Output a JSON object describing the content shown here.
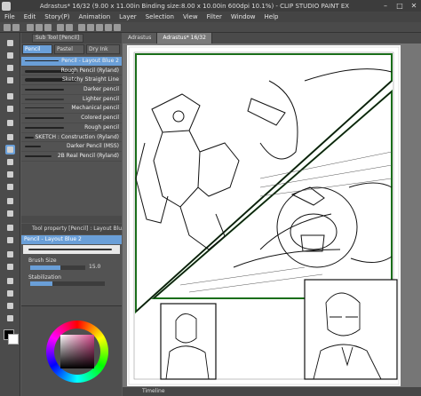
{
  "window": {
    "title": "Adrastus* 16/32 (9.00 x 11.00in Binding size:8.00 x 10.00in 600dpi 10.1%) - CLIP STUDIO PAINT EX",
    "minimize": "–",
    "maximize": "□",
    "close": "✕"
  },
  "menu": [
    "File",
    "Edit",
    "Story(P)",
    "Animation",
    "Layer",
    "Selection",
    "View",
    "Filter",
    "Window",
    "Help"
  ],
  "document_tabs": [
    "Adrastus",
    "Adrastus* 16/32"
  ],
  "subtool_panel": {
    "header": "Sub Tool [Pencil]",
    "tabs": [
      "Pencil",
      "Pastel",
      "Dry Ink"
    ],
    "active_tab": "Pencil",
    "brushes": [
      "Pencil - Layout Blue 2",
      "Rough Pencil (Ryland)",
      "Sketchy Straight Line",
      "Darker pencil",
      "Lighter pencil",
      "Mechanical pencil",
      "Colored pencil",
      "Rough pencil",
      "SKETCH : Construction (Ryland)",
      "Darker Pencil (MSS)",
      "2B Real Pencil (Ryland)"
    ],
    "selected_brush": "Pencil - Layout Blue 2"
  },
  "tool_property": {
    "header": "Tool property [Pencil] : Layout Blu...",
    "name": "Pencil - Layout Blue 2",
    "brush_size_label": "Brush Size",
    "brush_size_value": "15.0",
    "brush_size_fraction": 0.55,
    "stabilization_label": "Stabilization",
    "stabilization_fraction": 0.3
  },
  "colors": {
    "accent": "#6a9fd8",
    "main_color": "#000000",
    "sub_color": "#ffffff",
    "panel": "#535353",
    "border_green": "#1a6e1a"
  },
  "timeline": {
    "label": "Timeline"
  }
}
